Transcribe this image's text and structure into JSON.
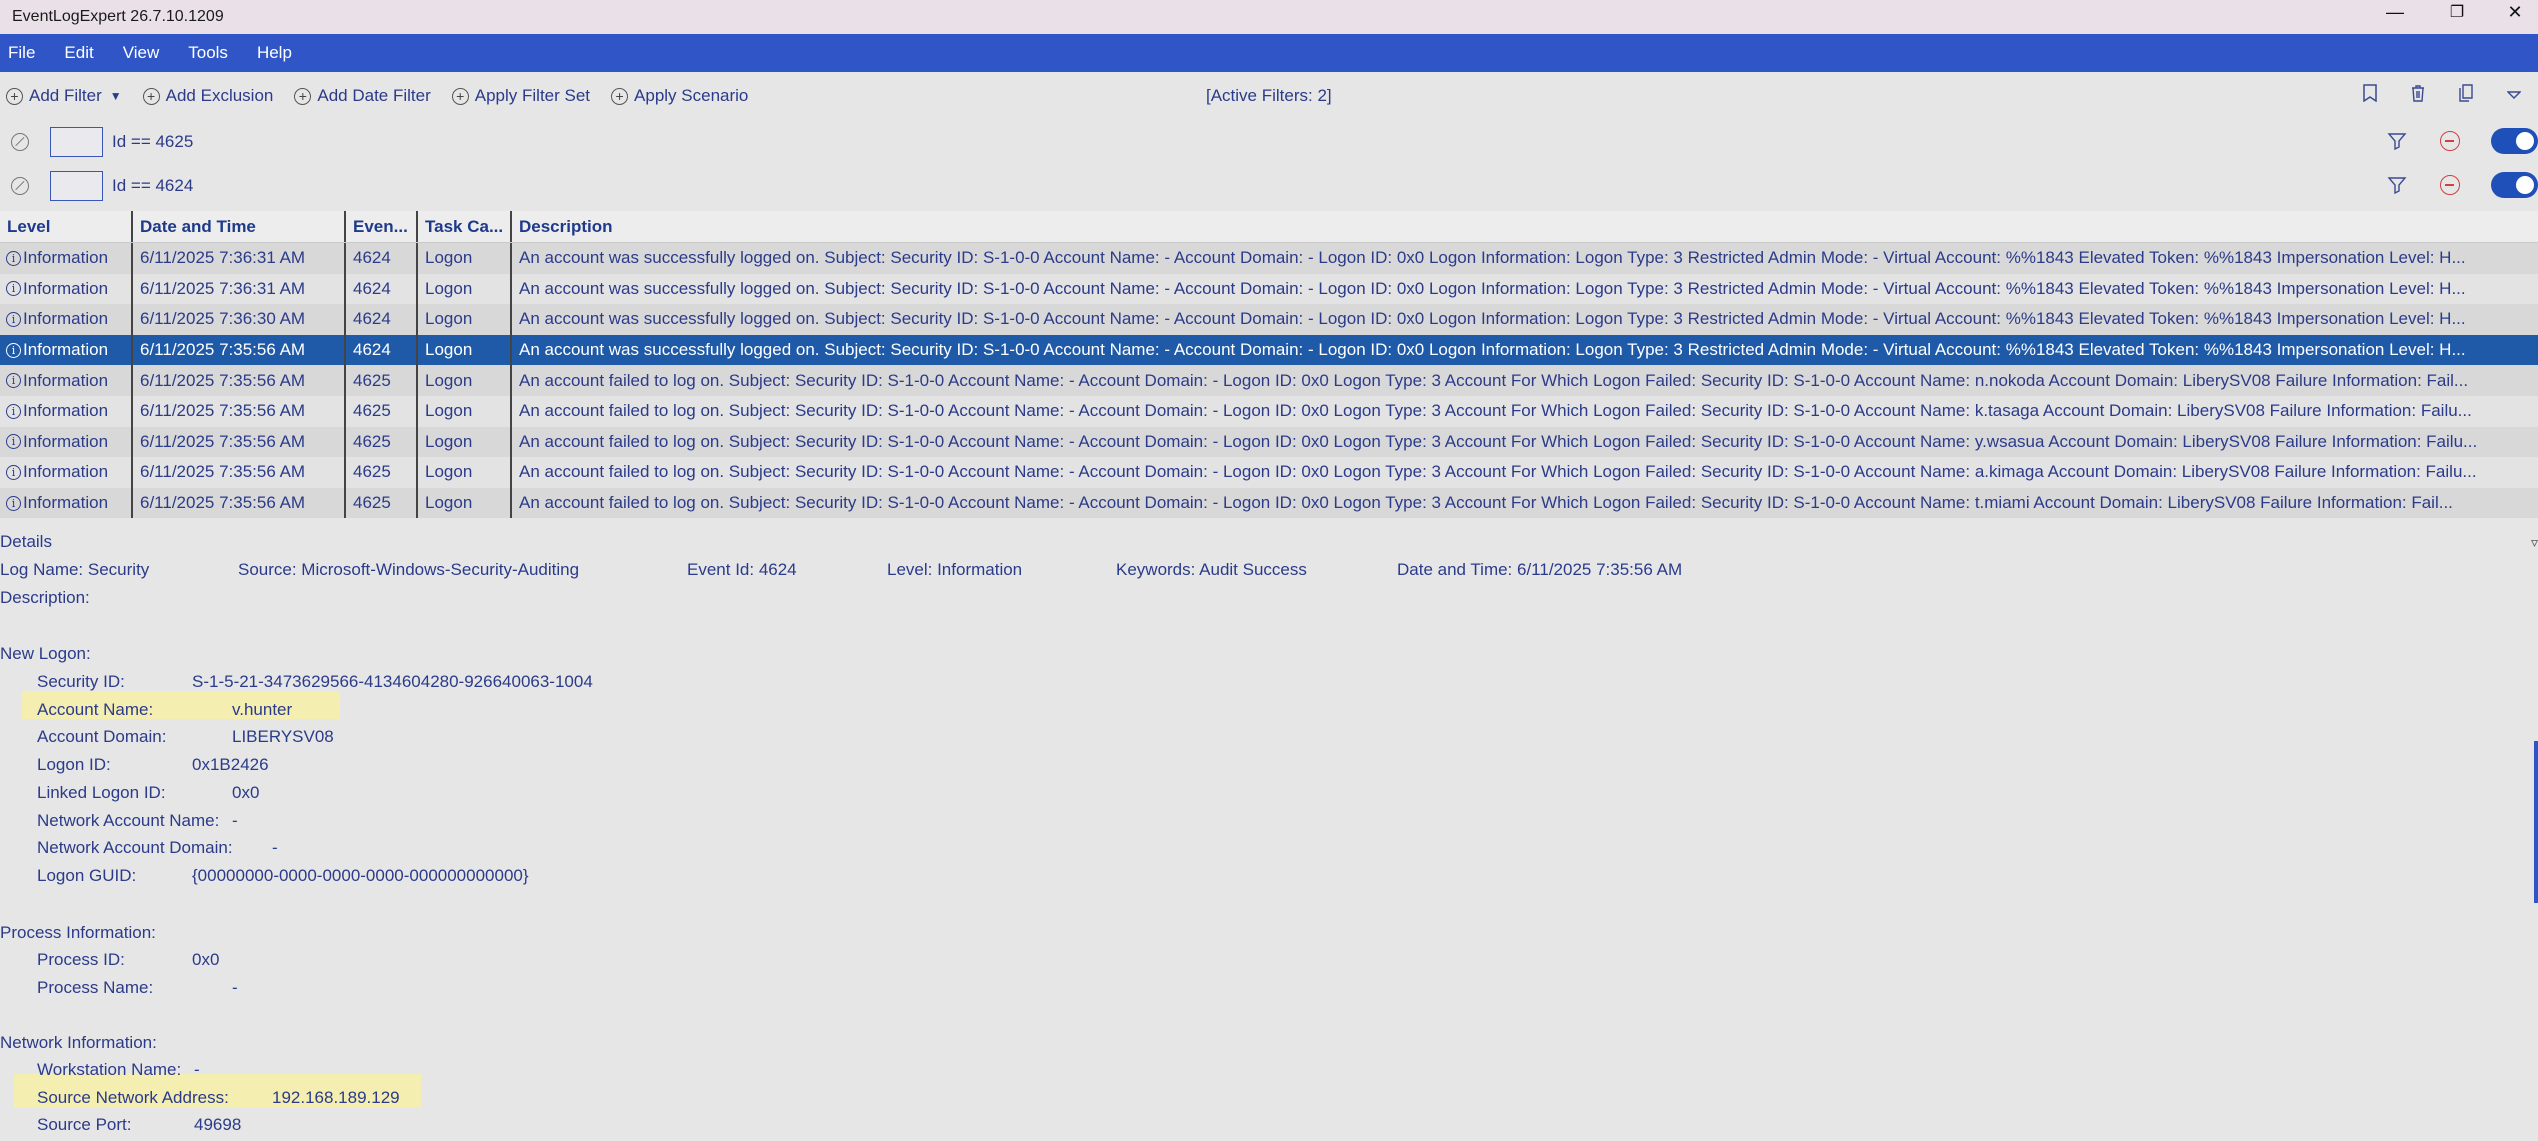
{
  "window": {
    "title": "EventLogExpert 26.7.10.1209",
    "minimize_glyph": "—",
    "restore_glyph": "❐",
    "close_glyph": "✕"
  },
  "menu": [
    "File",
    "Edit",
    "View",
    "Tools",
    "Help"
  ],
  "toolbar": {
    "add_filter": "Add Filter",
    "add_exclusion": "Add Exclusion",
    "add_date_filter": "Add Date Filter",
    "apply_filter_set": "Apply Filter Set",
    "apply_scenario": "Apply Scenario",
    "active_filters": "[Active Filters: 2]"
  },
  "filters": [
    {
      "expression": "Id == 4625",
      "enabled": true
    },
    {
      "expression": "Id == 4624",
      "enabled": true
    }
  ],
  "grid": {
    "headers": [
      "Level",
      "Date and Time",
      "Even...",
      "Task Ca...",
      "Description"
    ],
    "rows": [
      {
        "level": "Information",
        "date": "6/11/2025 7:36:31 AM",
        "id": "4624",
        "task": "Logon",
        "desc": "An account was successfully logged on. Subject: Security ID: S-1-0-0 Account Name: - Account Domain: - Logon ID: 0x0 Logon Information: Logon Type: 3 Restricted Admin Mode: - Virtual Account: %%1843 Elevated Token: %%1843 Impersonation Level: H..."
      },
      {
        "level": "Information",
        "date": "6/11/2025 7:36:31 AM",
        "id": "4624",
        "task": "Logon",
        "desc": "An account was successfully logged on. Subject: Security ID: S-1-0-0 Account Name: - Account Domain: - Logon ID: 0x0 Logon Information: Logon Type: 3 Restricted Admin Mode: - Virtual Account: %%1843 Elevated Token: %%1843 Impersonation Level: H..."
      },
      {
        "level": "Information",
        "date": "6/11/2025 7:36:30 AM",
        "id": "4624",
        "task": "Logon",
        "desc": "An account was successfully logged on. Subject: Security ID: S-1-0-0 Account Name: - Account Domain: - Logon ID: 0x0 Logon Information: Logon Type: 3 Restricted Admin Mode: - Virtual Account: %%1843 Elevated Token: %%1843 Impersonation Level: H..."
      },
      {
        "level": "Information",
        "date": "6/11/2025 7:35:56 AM",
        "id": "4624",
        "task": "Logon",
        "desc": "An account was successfully logged on. Subject: Security ID: S-1-0-0 Account Name: - Account Domain: - Logon ID: 0x0 Logon Information: Logon Type: 3 Restricted Admin Mode: - Virtual Account: %%1843 Elevated Token: %%1843 Impersonation Level: H...",
        "selected": true
      },
      {
        "level": "Information",
        "date": "6/11/2025 7:35:56 AM",
        "id": "4625",
        "task": "Logon",
        "desc": "An account failed to log on. Subject: Security ID: S-1-0-0 Account Name: - Account Domain: - Logon ID: 0x0 Logon Type: 3 Account For Which Logon Failed: Security ID: S-1-0-0 Account Name: n.nokoda Account Domain: LiberySV08 Failure Information: Fail..."
      },
      {
        "level": "Information",
        "date": "6/11/2025 7:35:56 AM",
        "id": "4625",
        "task": "Logon",
        "desc": "An account failed to log on. Subject: Security ID: S-1-0-0 Account Name: - Account Domain: - Logon ID: 0x0 Logon Type: 3 Account For Which Logon Failed: Security ID: S-1-0-0 Account Name: k.tasaga Account Domain: LiberySV08 Failure Information: Failu..."
      },
      {
        "level": "Information",
        "date": "6/11/2025 7:35:56 AM",
        "id": "4625",
        "task": "Logon",
        "desc": "An account failed to log on. Subject: Security ID: S-1-0-0 Account Name: - Account Domain: - Logon ID: 0x0 Logon Type: 3 Account For Which Logon Failed: Security ID: S-1-0-0 Account Name: y.wsasua Account Domain: LiberySV08 Failure Information: Failu..."
      },
      {
        "level": "Information",
        "date": "6/11/2025 7:35:56 AM",
        "id": "4625",
        "task": "Logon",
        "desc": "An account failed to log on. Subject: Security ID: S-1-0-0 Account Name: - Account Domain: - Logon ID: 0x0 Logon Type: 3 Account For Which Logon Failed: Security ID: S-1-0-0 Account Name: a.kimaga Account Domain: LiberySV08 Failure Information: Failu..."
      },
      {
        "level": "Information",
        "date": "6/11/2025 7:35:56 AM",
        "id": "4625",
        "task": "Logon",
        "desc": "An account failed to log on. Subject: Security ID: S-1-0-0 Account Name: - Account Domain: - Logon ID: 0x0 Logon Type: 3 Account For Which Logon Failed: Security ID: S-1-0-0 Account Name: t.miami Account Domain: LiberySV08 Failure Information: Fail..."
      }
    ]
  },
  "details": {
    "label": "Details",
    "collapse_glyph": "▿",
    "meta": {
      "log_name": "Log Name: Security",
      "source": "Source: Microsoft-Windows-Security-Auditing",
      "event_id": "Event Id: 4624",
      "level": "Level: Information",
      "keywords": "Keywords: Audit Success",
      "date": "Date and Time: 6/11/2025 7:35:56 AM"
    },
    "description_label": "Description:",
    "new_logon_header": "New Logon:",
    "new_logon": [
      {
        "k": "Security ID:",
        "v": "S-1-5-21-3473629566-4134604280-926640063-1004"
      },
      {
        "k": "Account Name:",
        "v": "v.hunter"
      },
      {
        "k": "Account Domain:",
        "v": "LIBERYSV08"
      },
      {
        "k": "Logon ID:",
        "v": "0x1B2426"
      },
      {
        "k": "Linked Logon ID:",
        "v": "0x0"
      },
      {
        "k": "Network Account Name:",
        "v": "-"
      },
      {
        "k": "Network Account Domain:",
        "v": "-"
      },
      {
        "k": "Logon GUID:",
        "v": "{00000000-0000-0000-0000-000000000000}"
      }
    ],
    "process_header": "Process Information:",
    "process": [
      {
        "k": "Process ID:",
        "v": "0x0"
      },
      {
        "k": "Process Name:",
        "v": "-"
      }
    ],
    "network_header": "Network Information:",
    "network": [
      {
        "k": "Workstation Name:",
        "v": "-"
      },
      {
        "k": "Source Network Address:",
        "v": "192.168.189.129"
      },
      {
        "k": "Source Port:",
        "v": "49698"
      }
    ]
  },
  "colors": {
    "menubar": "#2f55c6",
    "selected_row": "#1f5aa8",
    "highlight": "#f4eeb0",
    "toggle_on": "#1f4fb8"
  }
}
